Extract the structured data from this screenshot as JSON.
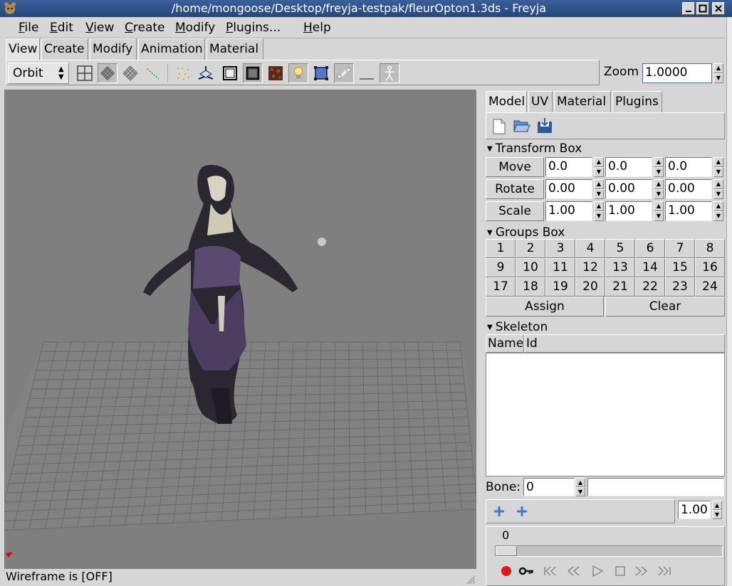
{
  "window": {
    "title": "/home/mongoose/Desktop/freyja-testpak/fleurOpton1.3ds - Freyja"
  },
  "menu": [
    {
      "key": "F",
      "rest": "ile"
    },
    {
      "key": "E",
      "rest": "dit"
    },
    {
      "key": "V",
      "rest": "iew"
    },
    {
      "key": "C",
      "rest": "reate"
    },
    {
      "key": "M",
      "rest": "odify"
    },
    {
      "key": "P",
      "rest": "lugins..."
    },
    {
      "key": "H",
      "rest": "elp"
    }
  ],
  "top_tabs": [
    "View",
    "Create",
    "Modify",
    "Animation",
    "Material"
  ],
  "toolbar": {
    "mode": "Orbit",
    "zoom_label": "Zoom",
    "zoom_value": "1.0000",
    "icons": [
      "four-view-icon",
      "wireframe-grid-icon",
      "mesh-grid-icon",
      "points-icon",
      "vertex-dots-icon",
      "axes-icon",
      "solid-box-icon",
      "shaded-box-icon",
      "texture-icon",
      "light-bulb-icon",
      "bbox-icon",
      "bone-icon",
      "moon-icon",
      "skeleton-icon"
    ]
  },
  "viewport": {
    "status": "Wireframe is [OFF]"
  },
  "right_tabs": [
    "Model",
    "UV",
    "Material",
    "Plugins"
  ],
  "transform": {
    "header": "Transform Box",
    "rows": [
      {
        "label": "Move",
        "values": [
          "0.0",
          "0.0",
          "0.0"
        ]
      },
      {
        "label": "Rotate",
        "values": [
          "0.00",
          "0.00",
          "0.00"
        ]
      },
      {
        "label": "Scale",
        "values": [
          "1.00",
          "1.00",
          "1.00"
        ]
      }
    ]
  },
  "groups": {
    "header": "Groups Box",
    "buttons": [
      "1",
      "2",
      "3",
      "4",
      "5",
      "6",
      "7",
      "8",
      "9",
      "10",
      "11",
      "12",
      "13",
      "14",
      "15",
      "16",
      "17",
      "18",
      "19",
      "20",
      "21",
      "22",
      "23",
      "24"
    ],
    "assign": "Assign",
    "clear": "Clear"
  },
  "skeleton": {
    "header": "Skeleton",
    "columns": [
      "Name",
      "Id"
    ],
    "bone_label": "Bone:",
    "bone_value": "0",
    "weight": "1.00"
  },
  "timeline": {
    "frame": "0"
  }
}
